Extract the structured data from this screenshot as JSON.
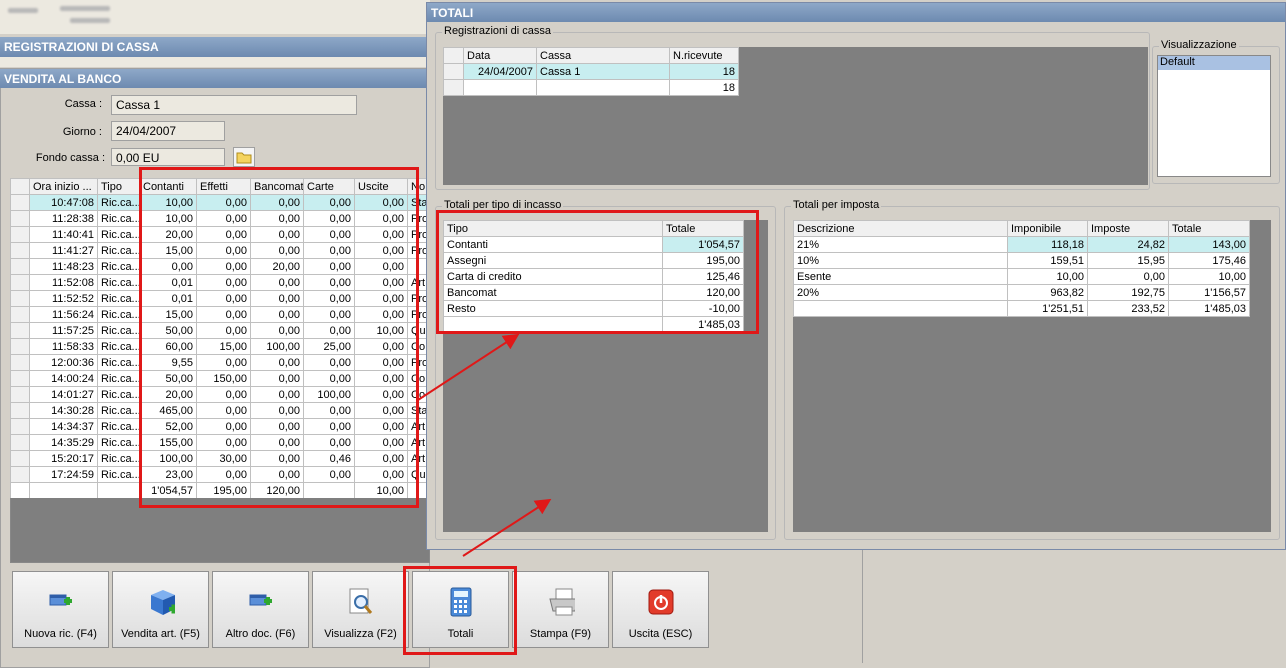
{
  "outer": {
    "reg_title": "REGISTRAZIONI DI CASSA",
    "vendita_title": "VENDITA AL BANCO"
  },
  "form": {
    "cassa_label": "Cassa :",
    "cassa_value": "Cassa 1",
    "giorno_label": "Giorno :",
    "giorno_value": "24/04/2007",
    "fondo_label": "Fondo cassa :",
    "fondo_value": "0,00 EU"
  },
  "main_table": {
    "headers": [
      "Ora inizio ...",
      "Tipo",
      "Contanti",
      "Effetti",
      "Bancomat",
      "Carte",
      "Uscite",
      "No"
    ],
    "rows": [
      [
        "10:47:08",
        "Ric.ca...",
        "10,00",
        "0,00",
        "0,00",
        "0,00",
        "0,00",
        "Sta"
      ],
      [
        "11:28:38",
        "Ric.ca...",
        "10,00",
        "0,00",
        "0,00",
        "0,00",
        "0,00",
        "Pro"
      ],
      [
        "11:40:41",
        "Ric.ca...",
        "20,00",
        "0,00",
        "0,00",
        "0,00",
        "0,00",
        "Pro"
      ],
      [
        "11:41:27",
        "Ric.ca...",
        "15,00",
        "0,00",
        "0,00",
        "0,00",
        "0,00",
        "Pro"
      ],
      [
        "11:48:23",
        "Ric.ca...",
        "0,00",
        "0,00",
        "20,00",
        "0,00",
        "0,00",
        ""
      ],
      [
        "11:52:08",
        "Ric.ca...",
        "0,01",
        "0,00",
        "0,00",
        "0,00",
        "0,00",
        "Art"
      ],
      [
        "11:52:52",
        "Ric.ca...",
        "0,01",
        "0,00",
        "0,00",
        "0,00",
        "0,00",
        "Pro"
      ],
      [
        "11:56:24",
        "Ric.ca...",
        "15,00",
        "0,00",
        "0,00",
        "0,00",
        "0,00",
        "Pro"
      ],
      [
        "11:57:25",
        "Ric.ca...",
        "50,00",
        "0,00",
        "0,00",
        "0,00",
        "10,00",
        "Qu"
      ],
      [
        "11:58:33",
        "Ric.ca...",
        "60,00",
        "15,00",
        "100,00",
        "25,00",
        "0,00",
        "Co"
      ],
      [
        "12:00:36",
        "Ric.ca...",
        "9,55",
        "0,00",
        "0,00",
        "0,00",
        "0,00",
        "Pro"
      ],
      [
        "14:00:24",
        "Ric.ca...",
        "50,00",
        "150,00",
        "0,00",
        "0,00",
        "0,00",
        "Co"
      ],
      [
        "14:01:27",
        "Ric.ca...",
        "20,00",
        "0,00",
        "0,00",
        "100,00",
        "0,00",
        "Co"
      ],
      [
        "14:30:28",
        "Ric.ca...",
        "465,00",
        "0,00",
        "0,00",
        "0,00",
        "0,00",
        "Sta"
      ],
      [
        "14:34:37",
        "Ric.ca...",
        "52,00",
        "0,00",
        "0,00",
        "0,00",
        "0,00",
        "Art"
      ],
      [
        "14:35:29",
        "Ric.ca...",
        "155,00",
        "0,00",
        "0,00",
        "0,00",
        "0,00",
        "Art"
      ],
      [
        "15:20:17",
        "Ric.ca...",
        "100,00",
        "30,00",
        "0,00",
        "0,46",
        "0,00",
        "Art"
      ],
      [
        "17:24:59",
        "Ric.ca...",
        "23,00",
        "0,00",
        "0,00",
        "0,00",
        "0,00",
        "Qu"
      ]
    ],
    "totals": [
      "",
      "",
      "1'054,57",
      "195,00",
      "120,00",
      "",
      "10,00",
      ""
    ]
  },
  "totali": {
    "title": "TOTALI",
    "reg_group": "Registrazioni di cassa",
    "reg_headers": [
      "Data",
      "Cassa",
      "N.ricevute"
    ],
    "reg_rows": [
      [
        "24/04/2007",
        "Cassa 1",
        "18"
      ],
      [
        "",
        "",
        "18"
      ]
    ],
    "vis_group": "Visualizzazione",
    "vis_item": "Default",
    "tipo_group": "Totali per tipo di incasso",
    "tipo_headers": [
      "Tipo",
      "Totale"
    ],
    "tipo_rows": [
      [
        "Contanti",
        "1'054,57"
      ],
      [
        "Assegni",
        "195,00"
      ],
      [
        "Carta di credito",
        "125,46"
      ],
      [
        "Bancomat",
        "120,00"
      ],
      [
        "Resto",
        "-10,00"
      ],
      [
        "",
        "1'485,03"
      ]
    ],
    "imp_group": "Totali per imposta",
    "imp_headers": [
      "Descrizione",
      "Imponibile",
      "Imposte",
      "Totale"
    ],
    "imp_rows": [
      [
        "21%",
        "118,18",
        "24,82",
        "143,00"
      ],
      [
        "10%",
        "159,51",
        "15,95",
        "175,46"
      ],
      [
        "Esente",
        "10,00",
        "0,00",
        "10,00"
      ],
      [
        "20%",
        "963,82",
        "192,75",
        "1'156,57"
      ],
      [
        "",
        "1'251,51",
        "233,52",
        "1'485,03"
      ]
    ]
  },
  "buttons": [
    {
      "label": "Nuova ric. (F4)",
      "icon": "add-window-icon"
    },
    {
      "label": "Vendita art. (F5)",
      "icon": "add-box-icon"
    },
    {
      "label": "Altro doc. (F6)",
      "icon": "add-window-icon"
    },
    {
      "label": "Visualizza (F2)",
      "icon": "magnifier-icon"
    },
    {
      "label": "Totali",
      "icon": "calculator-icon"
    },
    {
      "label": "Stampa (F9)",
      "icon": "printer-icon"
    },
    {
      "label": "Uscita (ESC)",
      "icon": "power-icon"
    }
  ]
}
